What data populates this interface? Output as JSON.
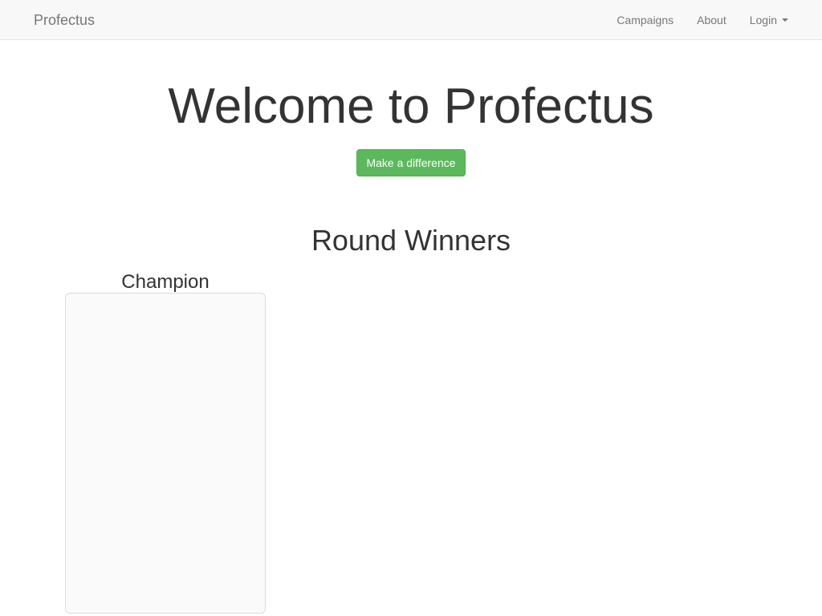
{
  "navbar": {
    "brand": "Profectus",
    "links": [
      {
        "label": "Campaigns"
      },
      {
        "label": "About"
      },
      {
        "label": "Login",
        "has_dropdown": true
      }
    ]
  },
  "hero": {
    "title": "Welcome to Profectus",
    "cta_label": "Make a difference",
    "cta_color": "#5cb85c"
  },
  "winners": {
    "title": "Round Winners",
    "cards": [
      {
        "heading": "Champion"
      }
    ]
  }
}
